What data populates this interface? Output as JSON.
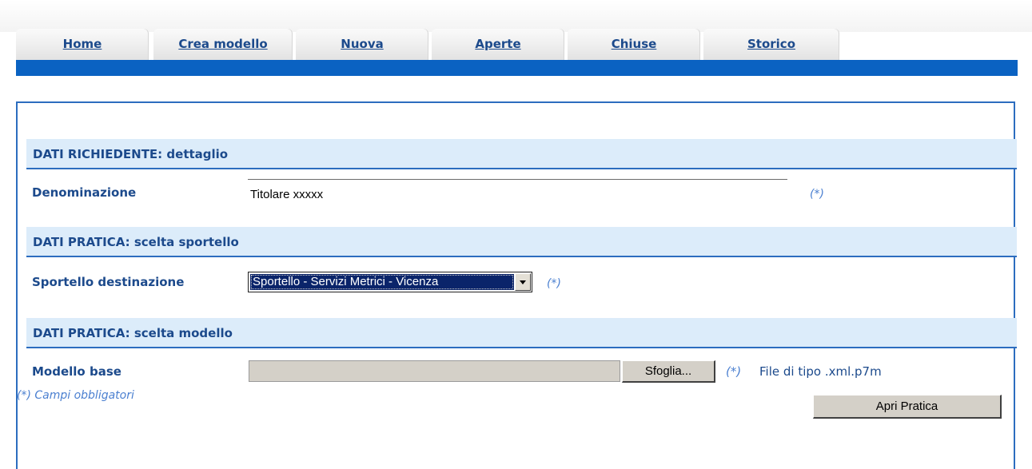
{
  "nav": {
    "tabs": [
      {
        "label": "Home"
      },
      {
        "label": "Crea modello"
      },
      {
        "label": "Nuova"
      },
      {
        "label": "Aperte"
      },
      {
        "label": "Chiuse"
      },
      {
        "label": "Storico"
      }
    ]
  },
  "sections": {
    "richiedente": {
      "title": "DATI RICHIEDENTE: dettaglio"
    },
    "sportello": {
      "title": "DATI PRATICA: scelta sportello"
    },
    "modello": {
      "title": "DATI PRATICA: scelta modello"
    }
  },
  "form": {
    "denominazione": {
      "label": "Denominazione",
      "value": "Titolare xxxxx"
    },
    "sportello": {
      "label": "Sportello destinazione",
      "selected": "Sportello - Servizi Metrici - Vicenza"
    },
    "modello": {
      "label": "Modello base",
      "value": "",
      "browse_label": "Sfoglia...",
      "hint": "File di tipo .xml.p7m"
    }
  },
  "required_marker": "(*)",
  "required_note": "(*) Campi obbligatori",
  "submit_label": "Apri Pratica",
  "colors": {
    "brand_blue": "#0a62c2",
    "label_blue": "#1c4a8c",
    "section_bg": "#dcecfa",
    "required_blue": "#4a7fd0"
  },
  "icons": {
    "dropdown": "triangle-down"
  }
}
